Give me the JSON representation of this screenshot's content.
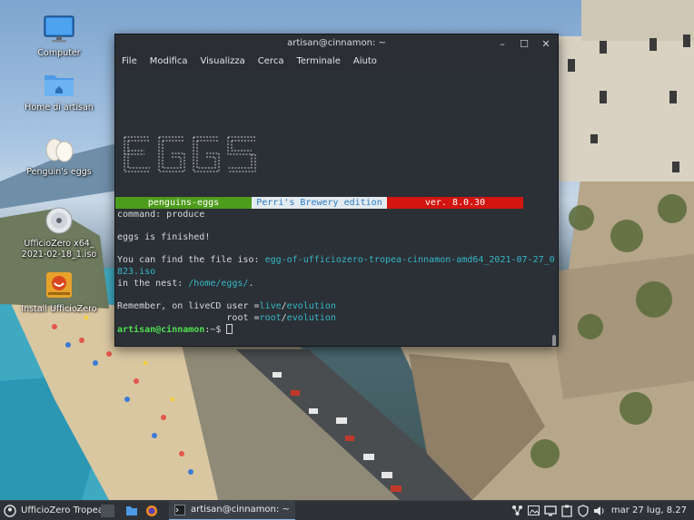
{
  "desktop": {
    "icons": [
      {
        "label": "Computer",
        "icon": "monitor-icon"
      },
      {
        "label": "Home di artisan",
        "icon": "folder-home-icon"
      },
      {
        "label": "Penguin's eggs",
        "icon": "eggs-icon"
      },
      {
        "label": "UfficioZero x64_ 2021-02-18_1.iso",
        "icon": "disc-icon"
      },
      {
        "label": "Install UfficioZero",
        "icon": "installer-icon"
      }
    ]
  },
  "terminal": {
    "title": "artisan@cinnamon: ~",
    "menu": [
      "File",
      "Modifica",
      "Visualizza",
      "Cerca",
      "Terminale",
      "Aiuto"
    ],
    "ascii_logo": [
      " ____  ____  ____  ____",
      "|      |      |      |    ",
      "|----  |  __  |  __  |____",
      "|      |    | |    |      |",
      "|____  |____| |____|  ____|"
    ],
    "banner": {
      "left": "penguins-eggs",
      "middle": "Perri's Brewery edition",
      "right": "ver. 8.0.30"
    },
    "lines": {
      "command": "command: produce",
      "finished": "eggs is finished!",
      "find_prefix": "You can find the file iso: ",
      "find_file_a": "egg-of-ufficiozero-tropea-cinnamon-amd64_2021-07-27_0",
      "find_file_b": "823.iso",
      "nest_prefix": "in the nest: ",
      "nest_path": "/home/eggs/",
      "nest_suffix": ".",
      "remember_prefix": "Remember, on liveCD user =",
      "live_user": "live",
      "slash1": "/",
      "live_pass": "evolution",
      "root_prefix": "                    root =",
      "root_user": "root",
      "slash2": "/",
      "root_pass": "evolution",
      "prompt": "artisan@cinnamon",
      "prompt_suffix": ":~$ "
    },
    "window_buttons": {
      "minimize": "–",
      "maximize": "☐",
      "close": "✕"
    }
  },
  "taskbar": {
    "menu_label": "UfficioZero Tropea",
    "task_label": "artisan@cinnamon: ~",
    "clock": "mar 27 lug,  8.27"
  },
  "colors": {
    "terminal_bg": "#2b2f36",
    "banner_green": "#4d9c1c",
    "banner_white": "#e4ebf0",
    "banner_red": "#d2150f",
    "cyan": "#35b8c7",
    "prompt_green": "#4fe050"
  }
}
